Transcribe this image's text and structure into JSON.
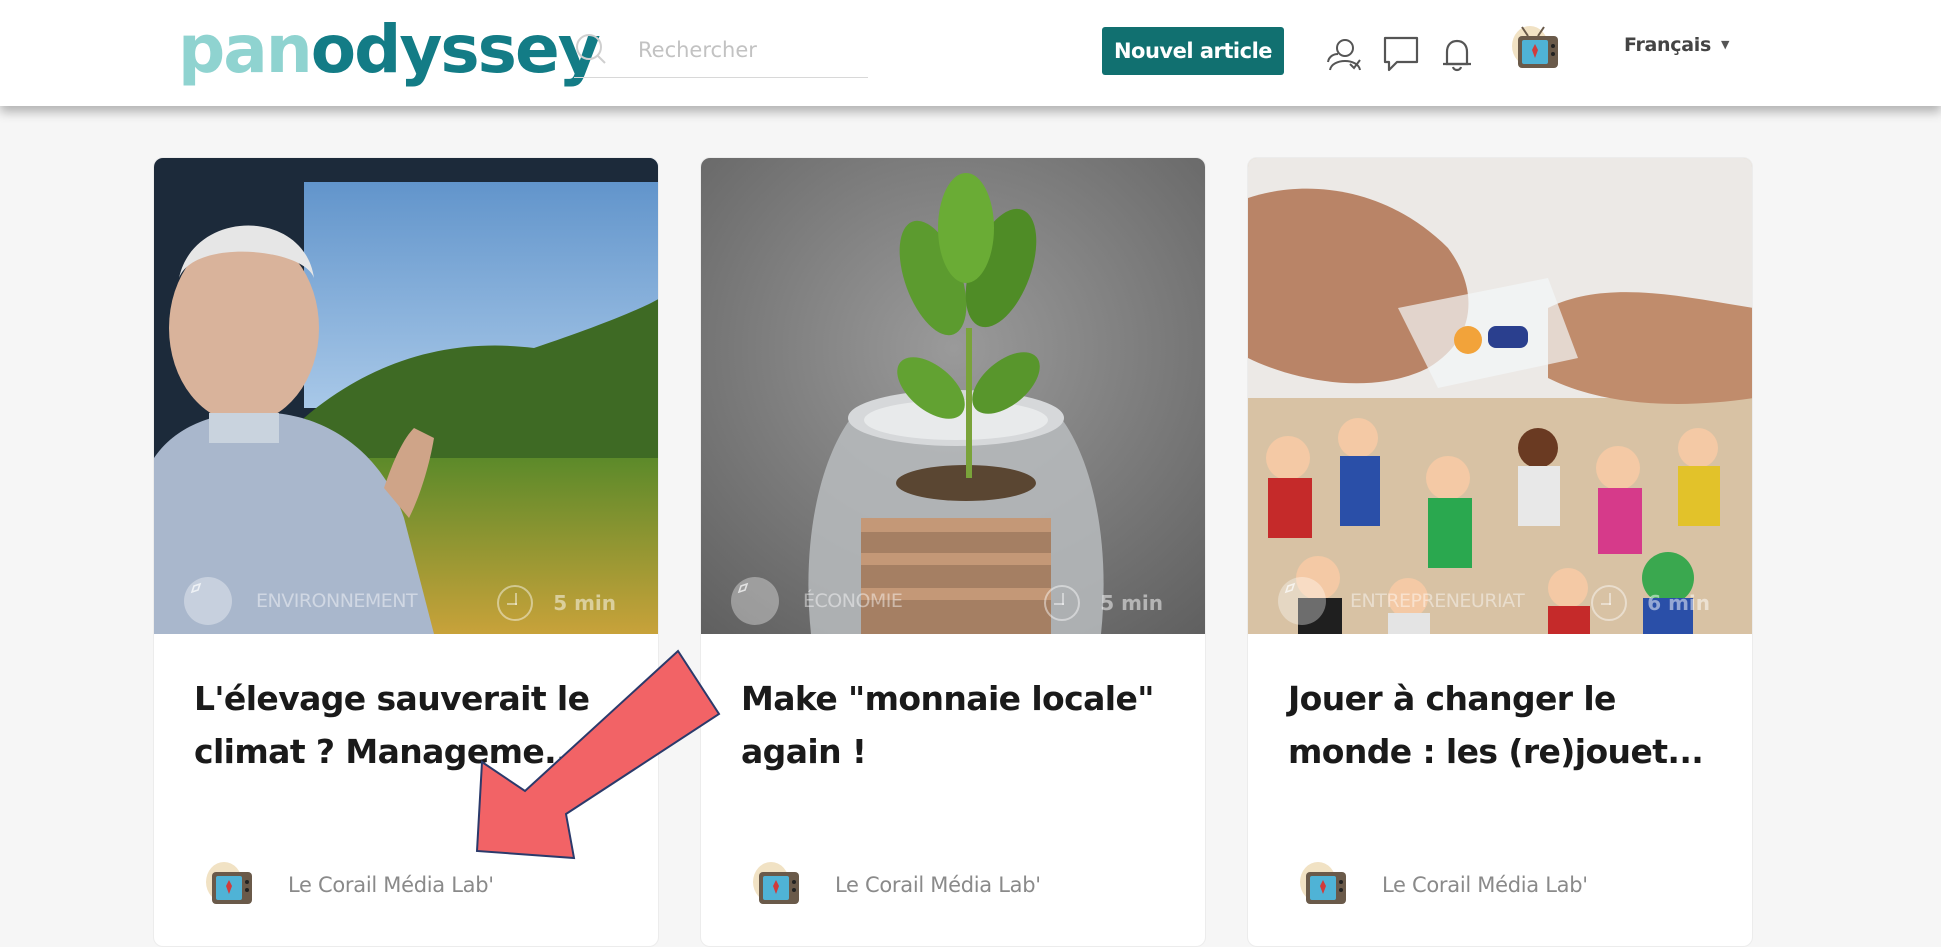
{
  "header": {
    "logo_part1": "pan",
    "logo_part2": "odyssey",
    "search_placeholder": "Rechercher",
    "new_article_label": "Nouvel article",
    "language": "Français"
  },
  "icons": {
    "search": "search-icon",
    "users": "users-icon",
    "messages": "chat-bubble-icon",
    "notifications": "bell-icon",
    "avatar": "tv-avatar-icon",
    "category": "compass-icon",
    "reading_time": "clock-icon"
  },
  "colors": {
    "brand_light": "#8fd3d0",
    "brand_dark": "#137c86",
    "button": "#117070",
    "annotation_arrow": "#f26366"
  },
  "articles": [
    {
      "category": "ENVIRONNEMENT",
      "reading_time": "5 min",
      "title": "L'élevage sauverait le climat ? Manageme...",
      "author": "Le Corail Média Lab'"
    },
    {
      "category": "ÉCONOMIE",
      "reading_time": "5 min",
      "title": "Make \"monnaie locale\" again !",
      "author": "Le Corail Média Lab'"
    },
    {
      "category": "ENTREPRENEURIAT",
      "reading_time": "6 min",
      "title": "Jouer à changer le monde : les (re)jouet...",
      "author": "Le Corail Média Lab'"
    }
  ]
}
